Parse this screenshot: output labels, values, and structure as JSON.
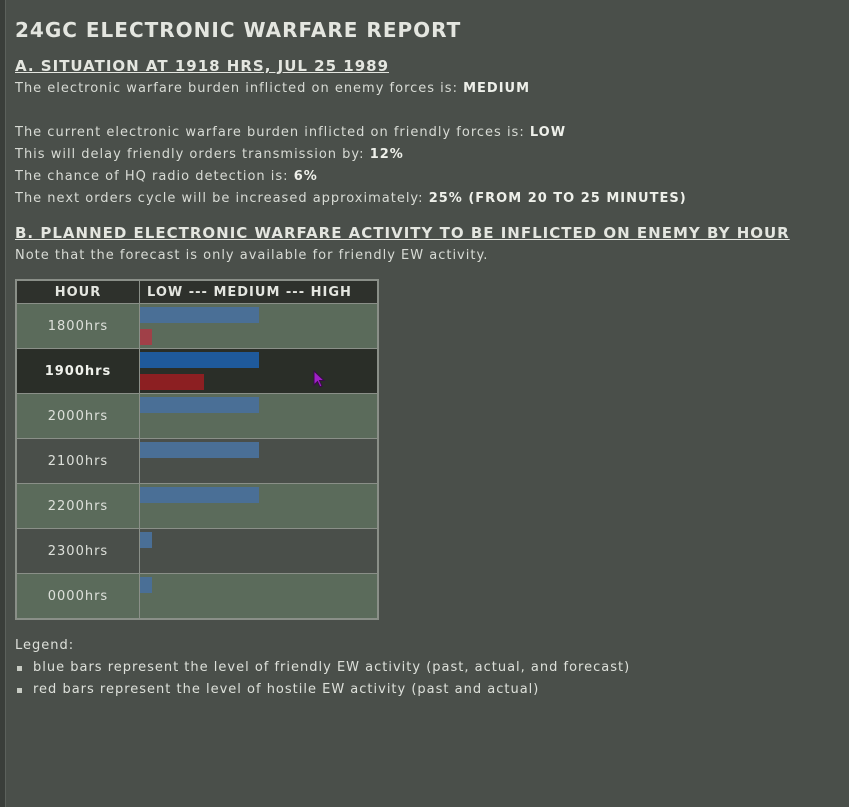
{
  "report": {
    "title": "24GC ELECTRONIC WARFARE REPORT",
    "section_a": {
      "heading": "A. SITUATION AT 1918 HRS, JUL 25 1989",
      "enemy_burden_label": "The electronic warfare burden inflicted on enemy forces is:",
      "enemy_burden_value": "MEDIUM",
      "friendly_burden_label": "The current electronic warfare burden inflicted on friendly forces is:",
      "friendly_burden_value": "LOW",
      "delay_label": "This will delay friendly orders transmission by:",
      "delay_value": "12%",
      "detection_label": "The chance of HQ radio detection is:",
      "detection_value": "6%",
      "orders_cycle_label": "The next orders cycle will be increased approximately:",
      "orders_cycle_value": "25% (FROM 20 TO 25 MINUTES)"
    },
    "section_b": {
      "heading": "B. PLANNED ELECTRONIC WARFARE ACTIVITY TO BE INFLICTED ON ENEMY BY HOUR",
      "note": "Note that the forecast is only available for friendly EW activity."
    },
    "table": {
      "header_hour": "HOUR",
      "header_level": "LOW --- MEDIUM --- HIGH",
      "rows": [
        {
          "hour": "1800hrs",
          "friendly": 0.5,
          "hostile": 0.05,
          "current": false
        },
        {
          "hour": "1900hrs",
          "friendly": 0.5,
          "hostile": 0.27,
          "current": true
        },
        {
          "hour": "2000hrs",
          "friendly": 0.5,
          "hostile": 0,
          "current": false
        },
        {
          "hour": "2100hrs",
          "friendly": 0.5,
          "hostile": 0,
          "current": false
        },
        {
          "hour": "2200hrs",
          "friendly": 0.5,
          "hostile": 0,
          "current": false
        },
        {
          "hour": "2300hrs",
          "friendly": 0.05,
          "hostile": 0,
          "current": false
        },
        {
          "hour": "0000hrs",
          "friendly": 0.05,
          "hostile": 0,
          "current": false
        }
      ]
    },
    "legend": {
      "title": "Legend:",
      "items": [
        "blue bars represent the level of friendly EW activity (past, actual, and forecast)",
        "red bars represent the level of hostile EW activity (past and actual)"
      ]
    },
    "colors": {
      "friendly_bar": "#4a6f96",
      "hostile_bar": "#a04048",
      "background": "#4a4f4a"
    }
  }
}
